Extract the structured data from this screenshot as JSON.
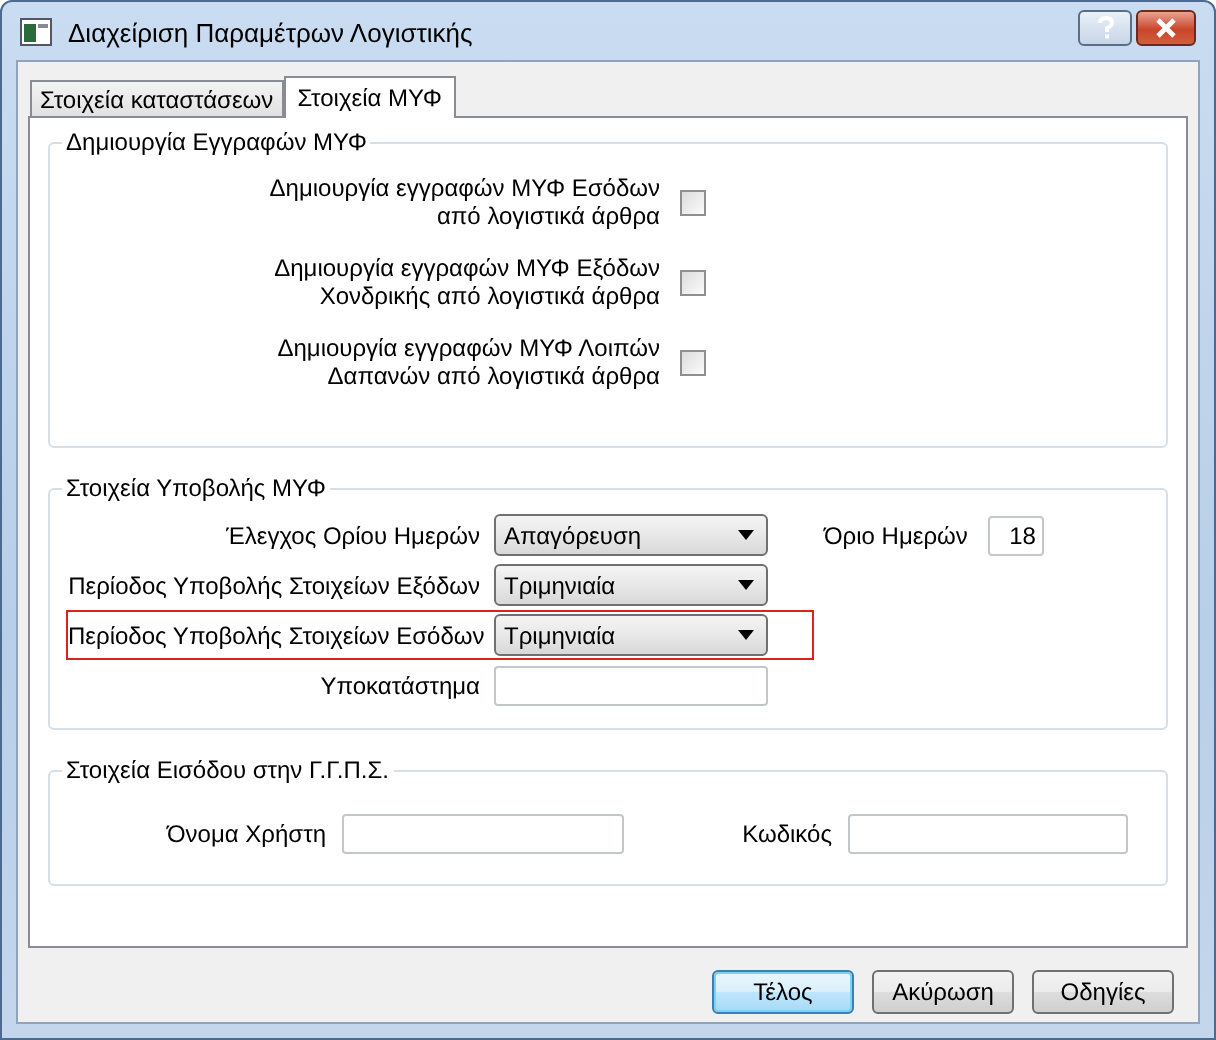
{
  "window": {
    "title": "Διαχείριση Παραμέτρων Λογιστικής"
  },
  "tabs": [
    {
      "label": "Στοιχεία καταστάσεων",
      "selected": false
    },
    {
      "label": "Στοιχεία ΜΥΦ",
      "selected": true
    }
  ],
  "groups": [
    {
      "title": "Δημιουργία Εγγραφών ΜΥΦ",
      "kind": "checkboxes",
      "rows": [
        {
          "label_lines": [
            "Δημιουργία εγγραφών ΜΥΦ Εσόδων",
            "από λογιστικά άρθρα"
          ],
          "checked": false
        },
        {
          "label_lines": [
            "Δημιουργία εγγραφών ΜΥΦ Εξόδων",
            "Χονδρικής από λογιστικά άρθρα"
          ],
          "checked": false
        },
        {
          "label_lines": [
            "Δημιουργία εγγραφών ΜΥΦ Λοιπών",
            "Δαπανών από λογιστικά άρθρα"
          ],
          "checked": false
        }
      ]
    },
    {
      "title": "Στοιχεία Υποβολής ΜΥΦ",
      "kind": "form",
      "rows": [
        {
          "label": "Έλεγχος Ορίου Ημερών",
          "kind": "dropdown",
          "value": "Απαγόρευση",
          "highlighted": false,
          "extra": {
            "label": "Όριο Ημερών",
            "value": "18"
          }
        },
        {
          "label": "Περίοδος Υποβολής Στοιχείων Εξόδων",
          "kind": "dropdown",
          "value": "Τριμηνιαία",
          "highlighted": false
        },
        {
          "label": "Περίοδος Υποβολής Στοιχείων Εσόδων",
          "kind": "dropdown",
          "value": "Τριμηνιαία",
          "highlighted": true
        },
        {
          "label": "Υποκατάστημα",
          "kind": "text",
          "highlighted": false
        }
      ]
    },
    {
      "title": "Στοιχεία Εισόδου στην Γ.Γ.Π.Σ.",
      "kind": "login",
      "fields": [
        {
          "label": "Όνομα Χρήστη"
        },
        {
          "label": "Κωδικός"
        }
      ]
    }
  ],
  "buttons": [
    {
      "label": "Τέλος",
      "default": true
    },
    {
      "label": "Ακύρωση",
      "default": false
    },
    {
      "label": "Οδηγίες",
      "default": false
    }
  ]
}
